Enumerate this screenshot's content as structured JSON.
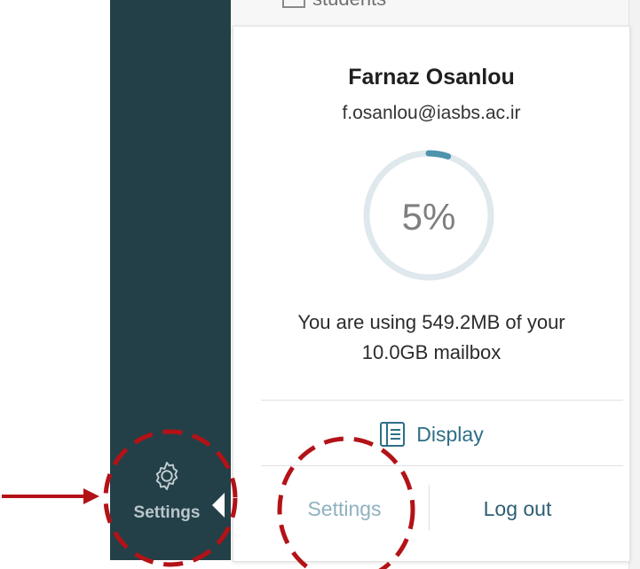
{
  "background_folder": {
    "label": "students"
  },
  "sidebar": {
    "settings_label": "Settings"
  },
  "account": {
    "name": "Farnaz Osanlou",
    "email": "f.osanlou@iasbs.ac.ir",
    "usage_percent_text": "5%",
    "usage_fraction": 0.05,
    "usage_line1": "You are using 549.2MB of your",
    "usage_line2": "10.0GB mailbox"
  },
  "menu": {
    "display_label": "Display",
    "settings_label": "Settings",
    "logout_label": "Log out"
  },
  "colors": {
    "sidebar": "#234048",
    "ring_track": "#dfe8ec",
    "ring_progress": "#4f93ad",
    "annotation": "#b31217"
  }
}
